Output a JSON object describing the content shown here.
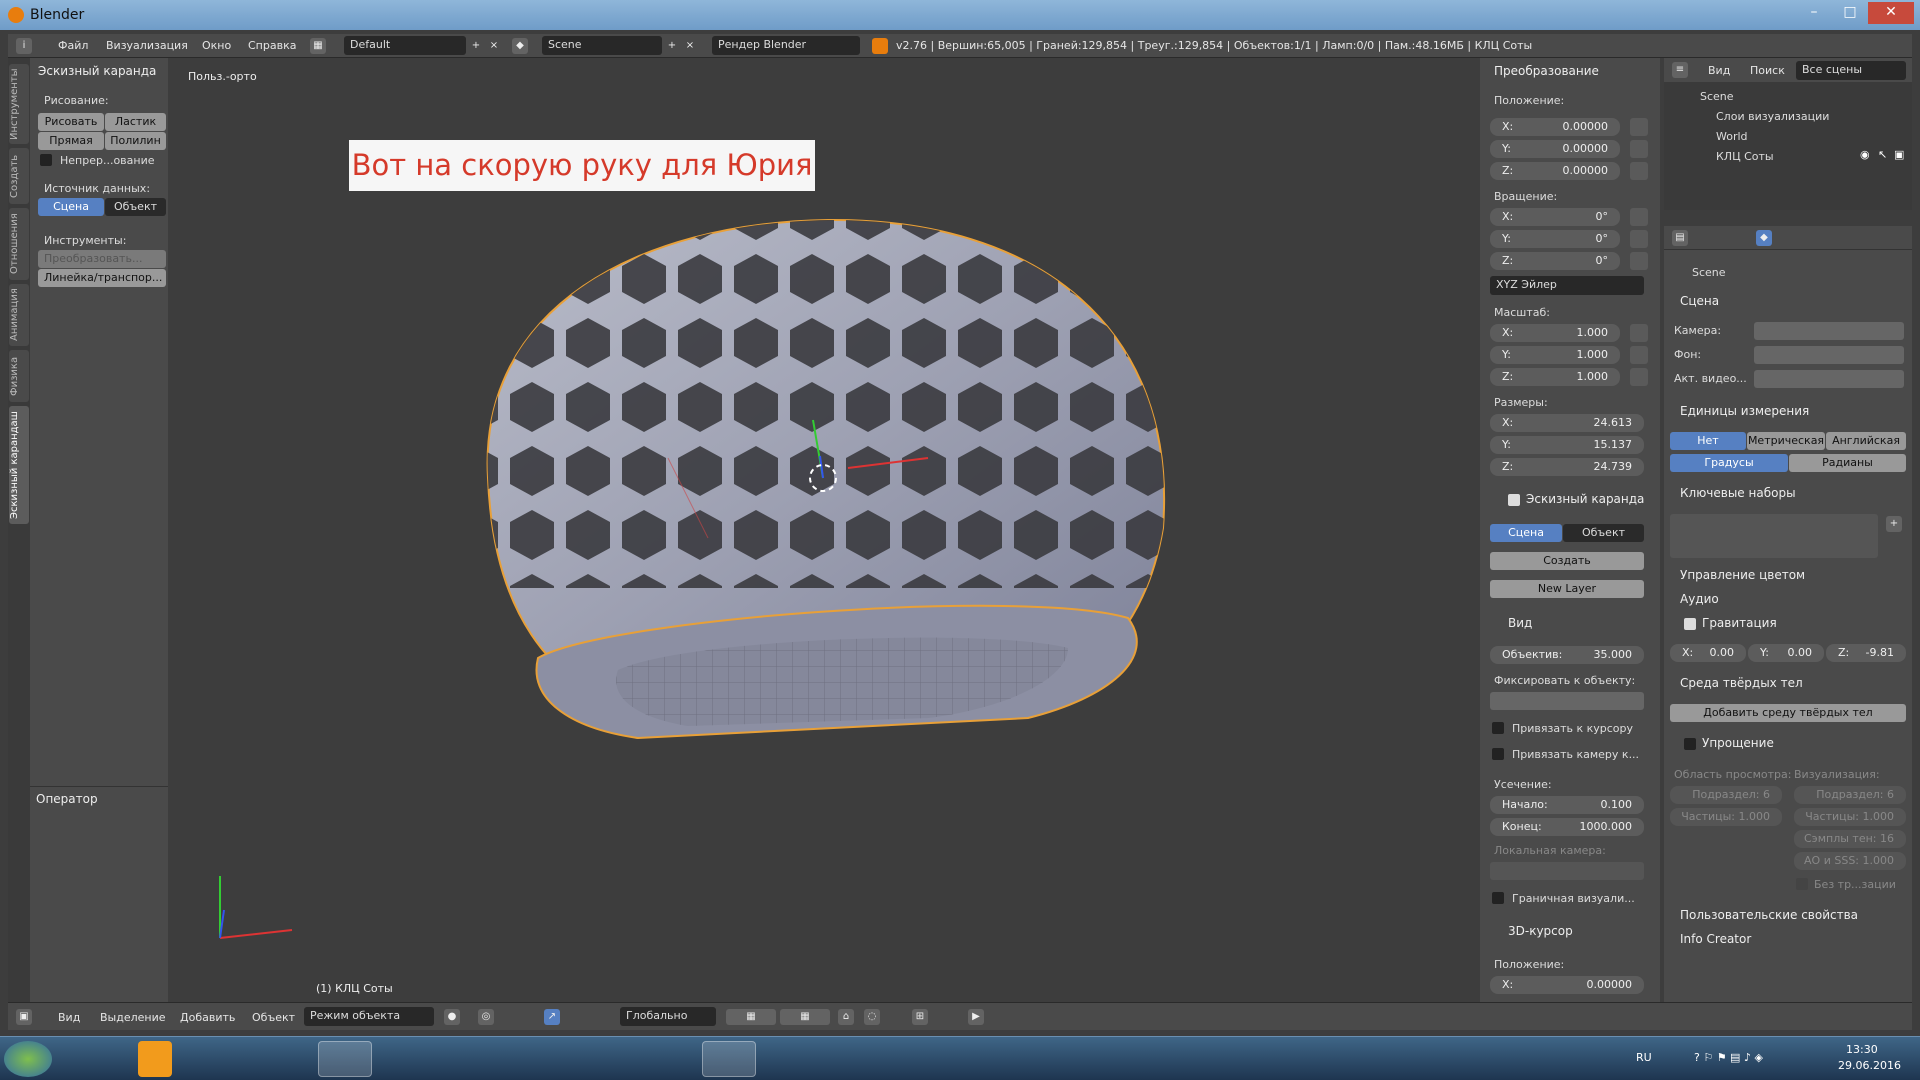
{
  "window": {
    "title": "Blender",
    "minimize": "–",
    "maximize": "□",
    "close": "✕"
  },
  "infobar": {
    "menus": [
      "Файл",
      "Визуализация",
      "Окно",
      "Справка"
    ],
    "layout": "Default",
    "scene": "Scene",
    "engine": "Рендер Blender",
    "stats": "v2.76 | Вершин:65,005 | Граней:129,854 | Треуг.:129,854 | Объектов:1/1 | Ламп:0/0 | Пам.:48.16МБ | КЛЦ Соты"
  },
  "toolshelf": {
    "tabs": [
      "Инструменты",
      "Создать",
      "Отношения",
      "Анимация",
      "Физика",
      "Эскизный карандаш"
    ],
    "panel_title": "Эскизный каранда",
    "drawing_label": "Рисование:",
    "draw": "Рисовать",
    "erase": "Ластик",
    "line": "Прямая",
    "poly": "Полилин",
    "continuous": "Непрер...ование",
    "source_label": "Источник данных:",
    "scene": "Сцена",
    "object": "Объект",
    "tools_label": "Инструменты:",
    "transform": "Преобразовать...",
    "ruler": "Линейка/транспор...",
    "operator": "Оператор"
  },
  "viewport": {
    "label": "Польз.-орто",
    "object_name": "(1) КЛЦ Соты",
    "banner": "Вот на скорую руку для Юрия"
  },
  "npanel": {
    "transform_title": "Преобразование",
    "location_label": "Положение:",
    "location": [
      {
        "k": "X:",
        "v": "0.00000"
      },
      {
        "k": "Y:",
        "v": "0.00000"
      },
      {
        "k": "Z:",
        "v": "0.00000"
      }
    ],
    "rotation_label": "Вращение:",
    "rotation": [
      {
        "k": "X:",
        "v": "0°"
      },
      {
        "k": "Y:",
        "v": "0°"
      },
      {
        "k": "Z:",
        "v": "0°"
      }
    ],
    "rotation_mode": "XYZ Эйлер",
    "scale_label": "Масштаб:",
    "scale": [
      {
        "k": "X:",
        "v": "1.000"
      },
      {
        "k": "Y:",
        "v": "1.000"
      },
      {
        "k": "Z:",
        "v": "1.000"
      }
    ],
    "dims_label": "Размеры:",
    "dims": [
      {
        "k": "X:",
        "v": "24.613"
      },
      {
        "k": "Y:",
        "v": "15.137"
      },
      {
        "k": "Z:",
        "v": "24.739"
      }
    ],
    "gp_title": "Эскизный каранда",
    "gp_scene": "Сцена",
    "gp_object": "Объект",
    "gp_create": "Создать",
    "gp_newlayer": "New Layer",
    "view_title": "Вид",
    "lens_k": "Объектив:",
    "lens_v": "35.000",
    "lock_label": "Фиксировать к объекту:",
    "lock_cursor": "Привязать к курсору",
    "lock_camera": "Привязать камеру к...",
    "clip_label": "Усечение:",
    "clip_start_k": "Начало:",
    "clip_start_v": "0.100",
    "clip_end_k": "Конец:",
    "clip_end_v": "1000.000",
    "local_cam": "Локальная камера:",
    "border_render": "Граничная визуали...",
    "cursor_title": "3D-курсор",
    "cursor_loc": "Положение:",
    "cursor_x_k": "X:",
    "cursor_x_v": "0.00000"
  },
  "outliner": {
    "view": "Вид",
    "search": "Поиск",
    "all_scenes": "Все сцены",
    "items": [
      "Scene",
      "Слои визуализации",
      "World",
      "КЛЦ Соты"
    ]
  },
  "props": {
    "scene_path": "Scene",
    "scene_title": "Сцена",
    "camera": "Камера:",
    "background": "Фон:",
    "active_clip": "Акт. видео...",
    "units_title": "Единицы измерения",
    "unit_none": "Нет",
    "unit_metric": "Метрическая",
    "unit_imperial": "Английская",
    "deg": "Градусы",
    "rad": "Радианы",
    "keying_title": "Ключевые наборы",
    "color_mgmt": "Управление цветом",
    "audio": "Аудио",
    "gravity": "Гравитация",
    "gx": "X:",
    "gxv": "0.00",
    "gy": "Y:",
    "gyv": "0.00",
    "gz": "Z:",
    "gzv": "-9.81",
    "rigid": "Среда твёрдых тел",
    "rigid_add": "Добавить среду твёрдых тел",
    "simplify": "Упрощение",
    "viewport_area": "Область просмотра:",
    "render": "Визуализация:",
    "subdiv1": "Подраздел: 6",
    "subdiv2": "Подраздел: 6",
    "part1": "Частицы: 1.000",
    "part2": "Частицы: 1.000",
    "shadow": "Сэмплы тен: 16",
    "ao": "АО и SSS: 1.000",
    "no_tr": "Без тр...зации",
    "custom": "Пользовательские свойства",
    "info": "Info Creator"
  },
  "bottombar": {
    "menus": [
      "Вид",
      "Выделение",
      "Добавить",
      "Объект"
    ],
    "mode": "Режим объекта",
    "orient": "Глобально"
  },
  "taskbar": {
    "lang": "RU",
    "time": "13:30",
    "date": "29.06.2016"
  },
  "colors": {
    "accent": "#5680c2",
    "selection": "#e8a038",
    "banner_text": "#d53a2a"
  }
}
